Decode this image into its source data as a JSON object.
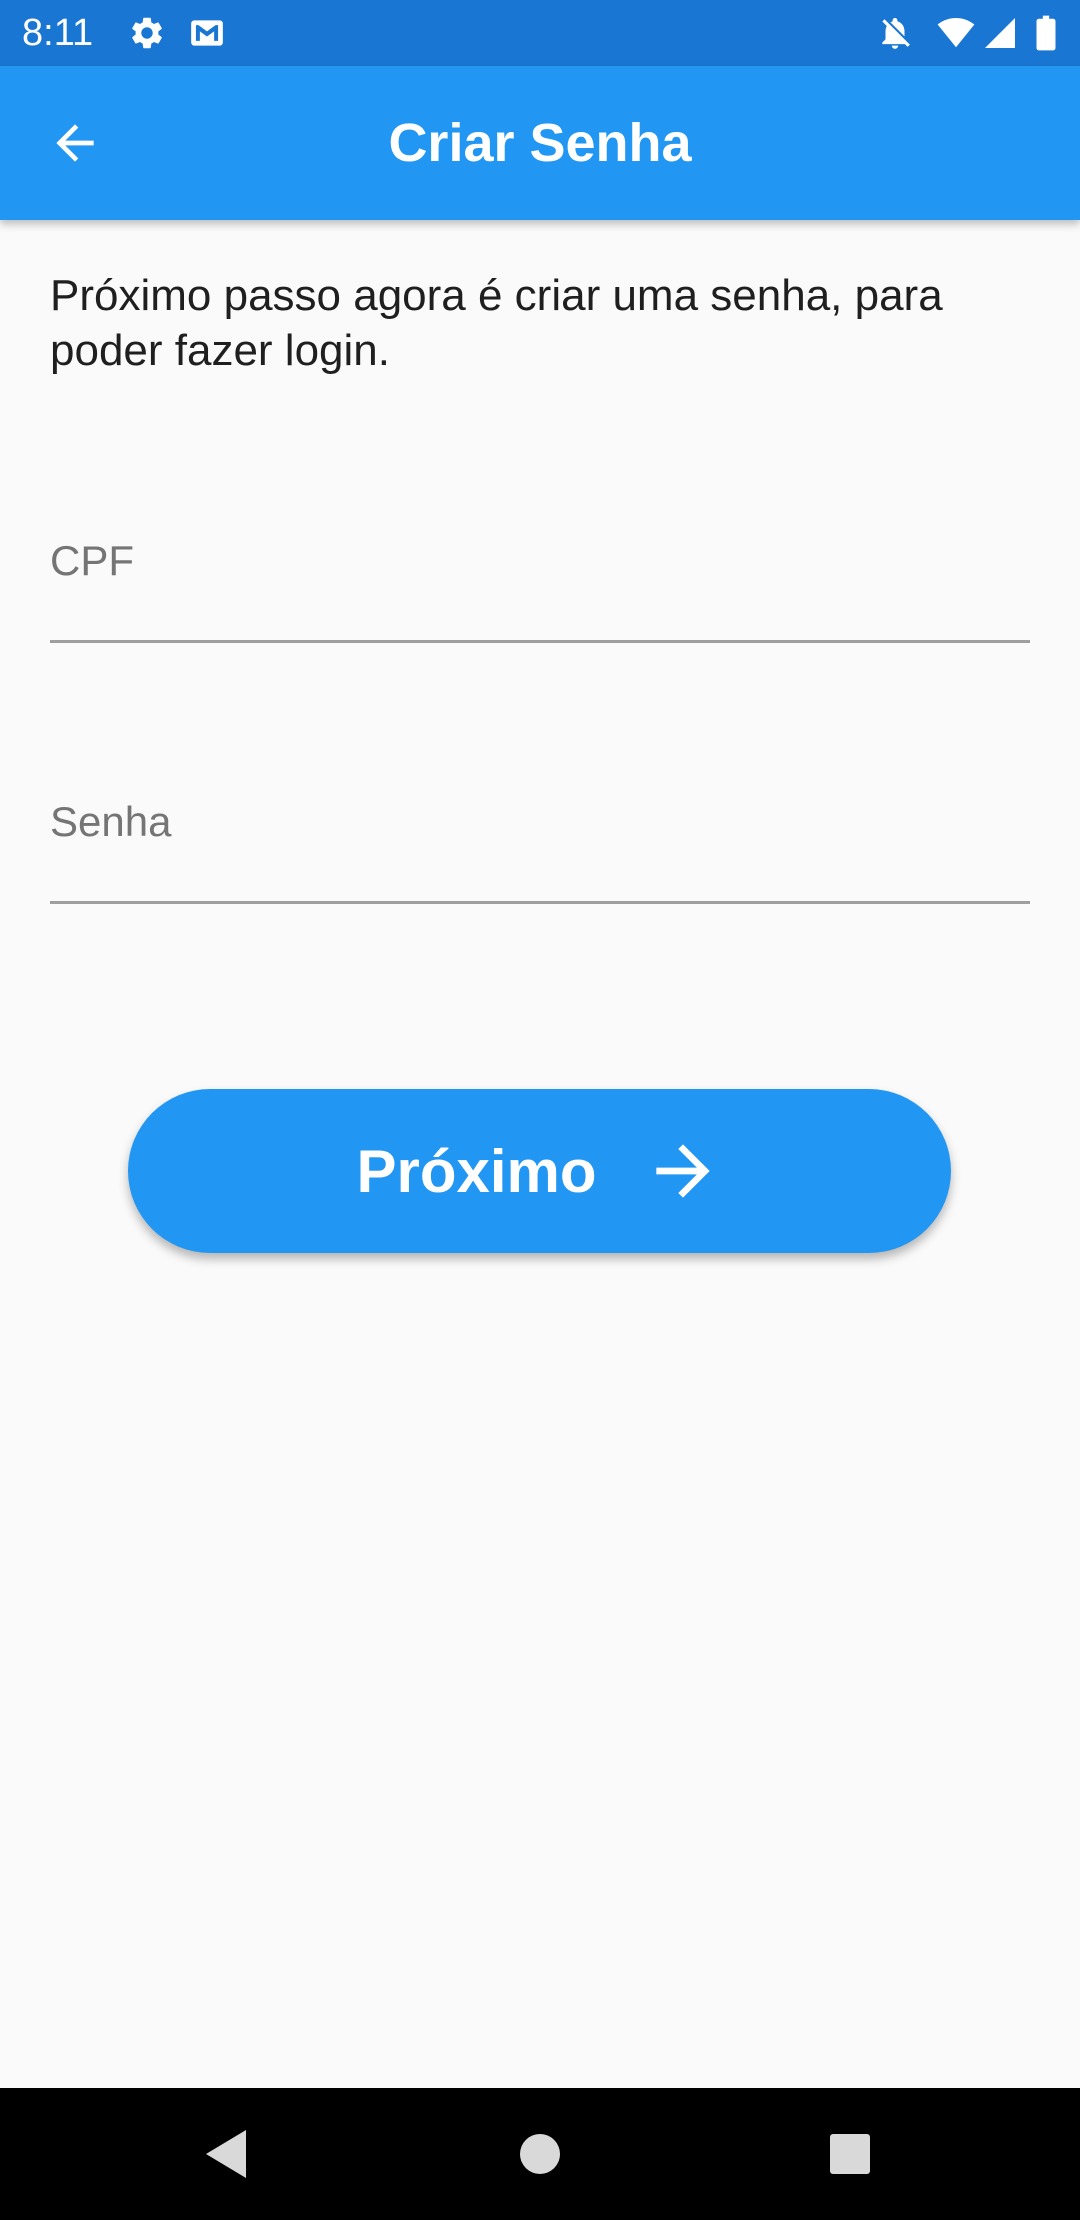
{
  "status_bar": {
    "time": "8:11",
    "icons": [
      "gear-icon",
      "gmail-icon",
      "notifications-off-icon",
      "wifi-icon",
      "signal-icon",
      "battery-icon"
    ]
  },
  "app_bar": {
    "title": "Criar Senha",
    "back_icon": "arrow-back-icon",
    "color": "#2196f3"
  },
  "intro_text": "Próximo passo agora é criar uma senha, para poder fazer login.",
  "form": {
    "cpf": {
      "label": "CPF",
      "value": ""
    },
    "password": {
      "label": "Senha",
      "value": ""
    }
  },
  "next_button": {
    "label": "Próximo",
    "icon": "arrow-forward-icon",
    "color": "#2196f3"
  },
  "nav_bar": {
    "icons": [
      "back-triangle-icon",
      "home-circle-icon",
      "recents-square-icon"
    ]
  }
}
